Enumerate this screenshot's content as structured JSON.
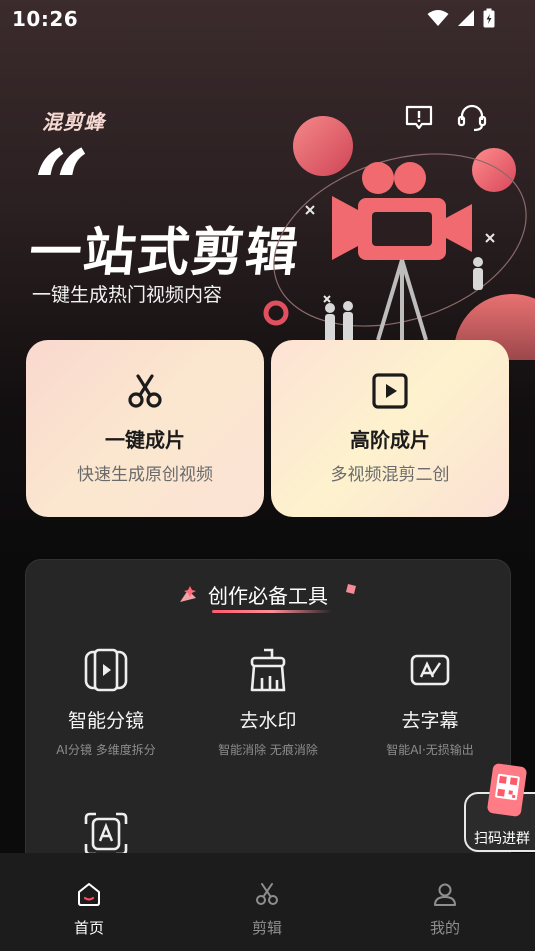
{
  "status_bar": {
    "time": "10:26"
  },
  "hero": {
    "logo": "混剪蜂",
    "quote": "“",
    "title": "一站式剪辑",
    "subtitle": "一键生成热门视频内容"
  },
  "cards": [
    {
      "title": "一键成片",
      "subtitle": "快速生成原创视频",
      "icon": "scissors-icon"
    },
    {
      "title": "高阶成片",
      "subtitle": "多视频混剪二创",
      "icon": "play-square-icon"
    }
  ],
  "tools": {
    "title": "创作必备工具",
    "items": [
      {
        "name": "智能分镜",
        "desc": "AI分镜 多维度拆分",
        "icon": "storyboard-icon"
      },
      {
        "name": "去水印",
        "desc": "智能消除 无痕消除",
        "icon": "eraser-brush-icon"
      },
      {
        "name": "去字幕",
        "desc": "智能AI·无损输出",
        "icon": "subtitle-remove-icon"
      },
      {
        "name": "",
        "desc": "",
        "icon": "text-scan-icon"
      }
    ]
  },
  "scan_button": {
    "label": "扫码进群"
  },
  "bottom_nav": {
    "items": [
      {
        "label": "首页",
        "icon": "home-icon",
        "active": true
      },
      {
        "label": "剪辑",
        "icon": "scissors-icon",
        "active": false
      },
      {
        "label": "我的",
        "icon": "user-icon",
        "active": false
      }
    ]
  },
  "colors": {
    "accent": "#ff5a6b",
    "card_gradient_start": "#fad8cf",
    "card_gradient_end": "#fdf2cd",
    "panel": "#262627",
    "nav_bg": "#1c1c1d"
  }
}
